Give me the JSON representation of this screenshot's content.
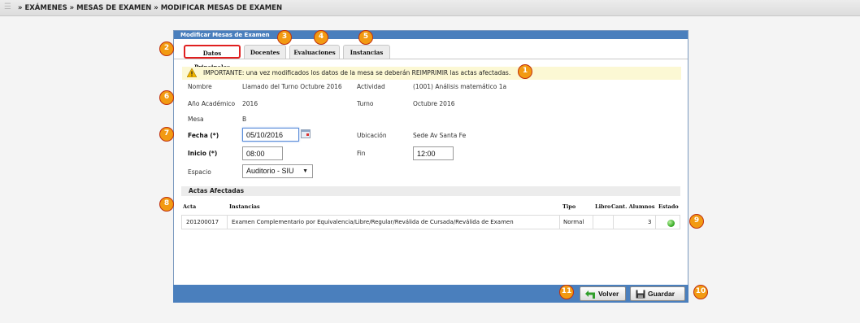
{
  "breadcrumb": "» EXÁMENES » MESAS DE EXAMEN » MODIFICAR MESAS DE EXAMEN",
  "panel_title": "Modificar Mesas de Examen",
  "tabs": [
    "Datos Principales",
    "Docentes",
    "Evaluaciones",
    "Instancias"
  ],
  "warning": "IMPORTANTE: una vez modificados los datos de la mesa se deberán REIMPRIMIR las actas afectadas.",
  "form": {
    "nombre_label": "Nombre",
    "nombre_value": "Llamado del Turno Octubre 2016",
    "actividad_label": "Actividad",
    "actividad_value": "(1001) Análisis matemático 1a",
    "anio_label": "Año Académico",
    "anio_value": "2016",
    "turno_label": "Turno",
    "turno_value": "Octubre 2016",
    "mesa_label": "Mesa",
    "mesa_value": "B",
    "fecha_label": "Fecha (*)",
    "fecha_value": "05/10/2016",
    "ubicacion_label": "Ubicación",
    "ubicacion_value": "Sede Av Santa Fe",
    "inicio_label": "Inicio (*)",
    "inicio_value": "08:00",
    "fin_label": "Fin",
    "fin_value": "12:00",
    "espacio_label": "Espacio",
    "espacio_value": "Auditorio - SIU"
  },
  "actas": {
    "title": "Actas Afectadas",
    "headers": [
      "Acta",
      "Instancias",
      "Tipo",
      "Libro",
      "Cant. Alumnos",
      "Estado"
    ],
    "rows": [
      {
        "acta": "201200017",
        "instancias": "Examen Complementario por Equivalencia/Libre/Regular/Reválida de Cursada/Reválida de Examen",
        "tipo": "Normal",
        "libro": "",
        "cant": "3",
        "estado_color": "#2ea31c"
      }
    ]
  },
  "buttons": {
    "volver": "Volver",
    "guardar": "Guardar"
  },
  "badges": [
    "1",
    "2",
    "3",
    "4",
    "5",
    "6",
    "7",
    "8",
    "9",
    "10",
    "11"
  ],
  "colors": {
    "header_blue": "#4a7fbd",
    "badge_orange": "#f29a12",
    "active_tab_border": "#e02020",
    "warning_bg": "#fcf8d4"
  }
}
